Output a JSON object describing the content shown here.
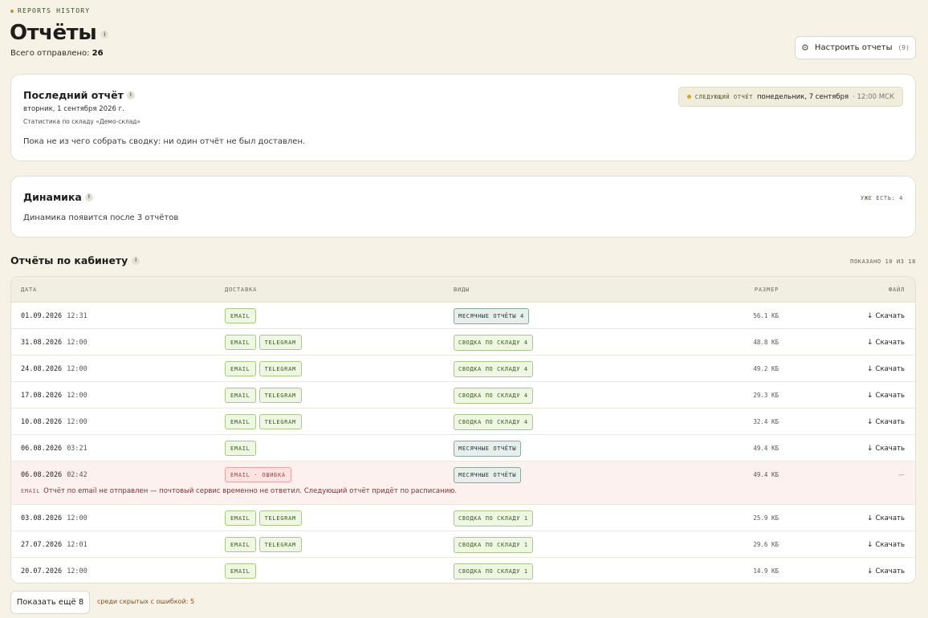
{
  "header": {
    "eyebrow": "REPORTS HISTORY",
    "title": "Отчёты",
    "total_label": "Всего отправлено:",
    "total_value": "26",
    "configure_label": "Настроить отчеты",
    "configure_count": "(9)"
  },
  "last_report": {
    "title": "Последний отчёт",
    "date": "вторник, 1 сентября 2026 г.",
    "subtitle": "Статистика по складу «Демо-склад»",
    "body": "Пока не из чего собрать сводку: ни один отчёт не был доставлен.",
    "next_label": "СЛЕДУЮЩИЙ ОТЧЁТ",
    "next_date": "понедельник, 7 сентября",
    "next_time": "· 12:00 МСК"
  },
  "dynamics": {
    "title": "Динамика",
    "already": "УЖЕ ЕСТЬ: 4",
    "body": "Динамика появится после 3 отчётов"
  },
  "section": {
    "title": "Отчёты по кабинету",
    "shown": "ПОКАЗАНО 10 ИЗ 18"
  },
  "table": {
    "columns": {
      "date": "ДАТА",
      "delivery": "ДОСТАВКА",
      "kinds": "ВИДЫ",
      "size": "РАЗМЕР",
      "file": "ФАЙЛ"
    },
    "rows": [
      {
        "date": "01.09.2026",
        "time": "12:31",
        "delivery": [
          "EMAIL"
        ],
        "kind": "МЕСЯЧНЫЕ ОТЧЁТЫ 4",
        "kind_style": "teal",
        "size": "56.1 КБ",
        "file": "Скачать"
      },
      {
        "date": "31.08.2026",
        "time": "12:00",
        "delivery": [
          "EMAIL",
          "TELEGRAM"
        ],
        "kind": "СВОДКА ПО СКЛАДУ 4",
        "kind_style": "green",
        "size": "48.8 КБ",
        "file": "Скачать"
      },
      {
        "date": "24.08.2026",
        "time": "12:00",
        "delivery": [
          "EMAIL",
          "TELEGRAM"
        ],
        "kind": "СВОДКА ПО СКЛАДУ 4",
        "kind_style": "green",
        "size": "49.2 КБ",
        "file": "Скачать"
      },
      {
        "date": "17.08.2026",
        "time": "12:00",
        "delivery": [
          "EMAIL",
          "TELEGRAM"
        ],
        "kind": "СВОДКА ПО СКЛАДУ 4",
        "kind_style": "green",
        "size": "29.3 КБ",
        "file": "Скачать"
      },
      {
        "date": "10.08.2026",
        "time": "12:00",
        "delivery": [
          "EMAIL",
          "TELEGRAM"
        ],
        "kind": "СВОДКА ПО СКЛАДУ 4",
        "kind_style": "green",
        "size": "32.4 КБ",
        "file": "Скачать"
      },
      {
        "date": "06.08.2026",
        "time": "03:21",
        "delivery": [
          "EMAIL"
        ],
        "kind": "МЕСЯЧНЫЕ ОТЧЁТЫ",
        "kind_style": "teal",
        "size": "49.4 КБ",
        "file": "Скачать"
      },
      {
        "date": "06.08.2026",
        "time": "02:42",
        "delivery_error": "EMAIL · ОШИБКА",
        "kind": "МЕСЯЧНЫЕ ОТЧЁТЫ",
        "kind_style": "teal",
        "size": "49.4 КБ",
        "file": "—",
        "error_channel": "EMAIL",
        "error_text": "Отчёт по email не отправлен — почтовый сервис временно не ответил. Следующий отчёт придёт по расписанию."
      },
      {
        "date": "03.08.2026",
        "time": "12:00",
        "delivery": [
          "EMAIL",
          "TELEGRAM"
        ],
        "kind": "СВОДКА ПО СКЛАДУ 1",
        "kind_style": "green",
        "size": "25.9 КБ",
        "file": "Скачать"
      },
      {
        "date": "27.07.2026",
        "time": "12:01",
        "delivery": [
          "EMAIL",
          "TELEGRAM"
        ],
        "kind": "СВОДКА ПО СКЛАДУ 1",
        "kind_style": "green",
        "size": "29.6 КБ",
        "file": "Скачать"
      },
      {
        "date": "20.07.2026",
        "time": "12:00",
        "delivery": [
          "EMAIL"
        ],
        "kind": "СВОДКА ПО СКЛАДУ 1",
        "kind_style": "green",
        "size": "14.9 КБ",
        "file": "Скачать"
      }
    ]
  },
  "footer": {
    "show_more": "Показать ещё 8",
    "hidden_errors": "среди скрытых с ошибкой: 5"
  },
  "icons": {
    "info": "info-icon",
    "gear": "gear-icon",
    "download": "download-arrow-icon"
  }
}
